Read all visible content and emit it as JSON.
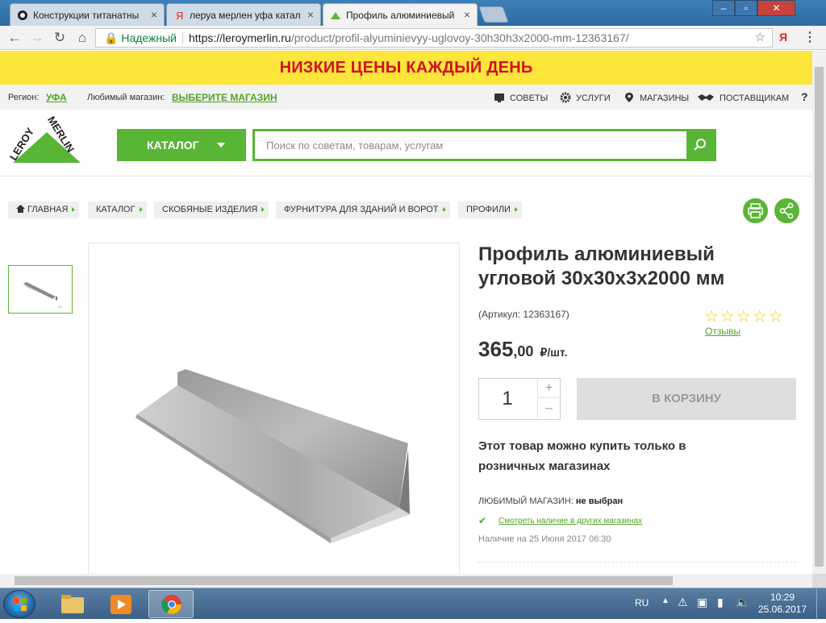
{
  "browser": {
    "tabs": [
      {
        "title": "Конструкции титанатны",
        "active": false
      },
      {
        "title": "леруа мерлен уфа катал",
        "active": false
      },
      {
        "title": "Профиль алюминиевый",
        "active": true
      }
    ],
    "secure_label": "Надежный",
    "url_host": "https://leroymerlin.ru",
    "url_path": "/product/profil-alyuminievyy-uglovoy-30h30h3x2000-mm-12363167/",
    "ext_label": "Я"
  },
  "promo": {
    "text": "НИЗКИЕ ЦЕНЫ КАЖДЫЙ ДЕНЬ"
  },
  "infobar": {
    "region_label": "Регион:",
    "region_value": "УФА",
    "store_label": "Любимый магазин:",
    "store_value": "ВЫБЕРИТЕ МАГАЗИН",
    "links": [
      "СОВЕТЫ",
      "УСЛУГИ",
      "МАГАЗИНЫ",
      "ПОСТАВЩИКАМ"
    ],
    "help": "?"
  },
  "header": {
    "catalog_label": "КАТАЛОГ",
    "search_placeholder": "Поиск по советам, товарам, услугам"
  },
  "breadcrumbs": [
    "ГЛАВНАЯ",
    "КАТАЛОГ",
    "СКОБЯНЫЕ ИЗДЕЛИЯ",
    "ФУРНИТУРА ДЛЯ ЗДАНИЙ И ВОРОТ",
    "ПРОФИЛИ"
  ],
  "product": {
    "title": "Профиль алюминиевый угловой 30x30x3x2000 мм",
    "article": "(Артикул: 12363167)",
    "stars": "☆☆☆☆☆",
    "reviews_label": "Отзывы",
    "price_int": "365",
    "price_dec": ",00",
    "price_unit": "₽/шт.",
    "quantity": "1",
    "qty_plus": "+",
    "qty_minus": "–",
    "cart_label": "В КОРЗИНУ",
    "retail_note": "Этот товар можно купить только в розничных магазинах",
    "fav_store_label": "ЛЮБИМЫЙ МАГАЗИН:",
    "fav_store_value": "не выбран",
    "availability_link": "Смотреть наличие в других магазинах",
    "availability_date": "Наличие на 25 Июня 2017 06:30"
  },
  "taskbar": {
    "lang": "RU",
    "time": "10:29",
    "date": "25.06.2017"
  },
  "colors": {
    "accent": "#58b535",
    "promo_bg": "#fde53b",
    "promo_text": "#d4101c"
  }
}
